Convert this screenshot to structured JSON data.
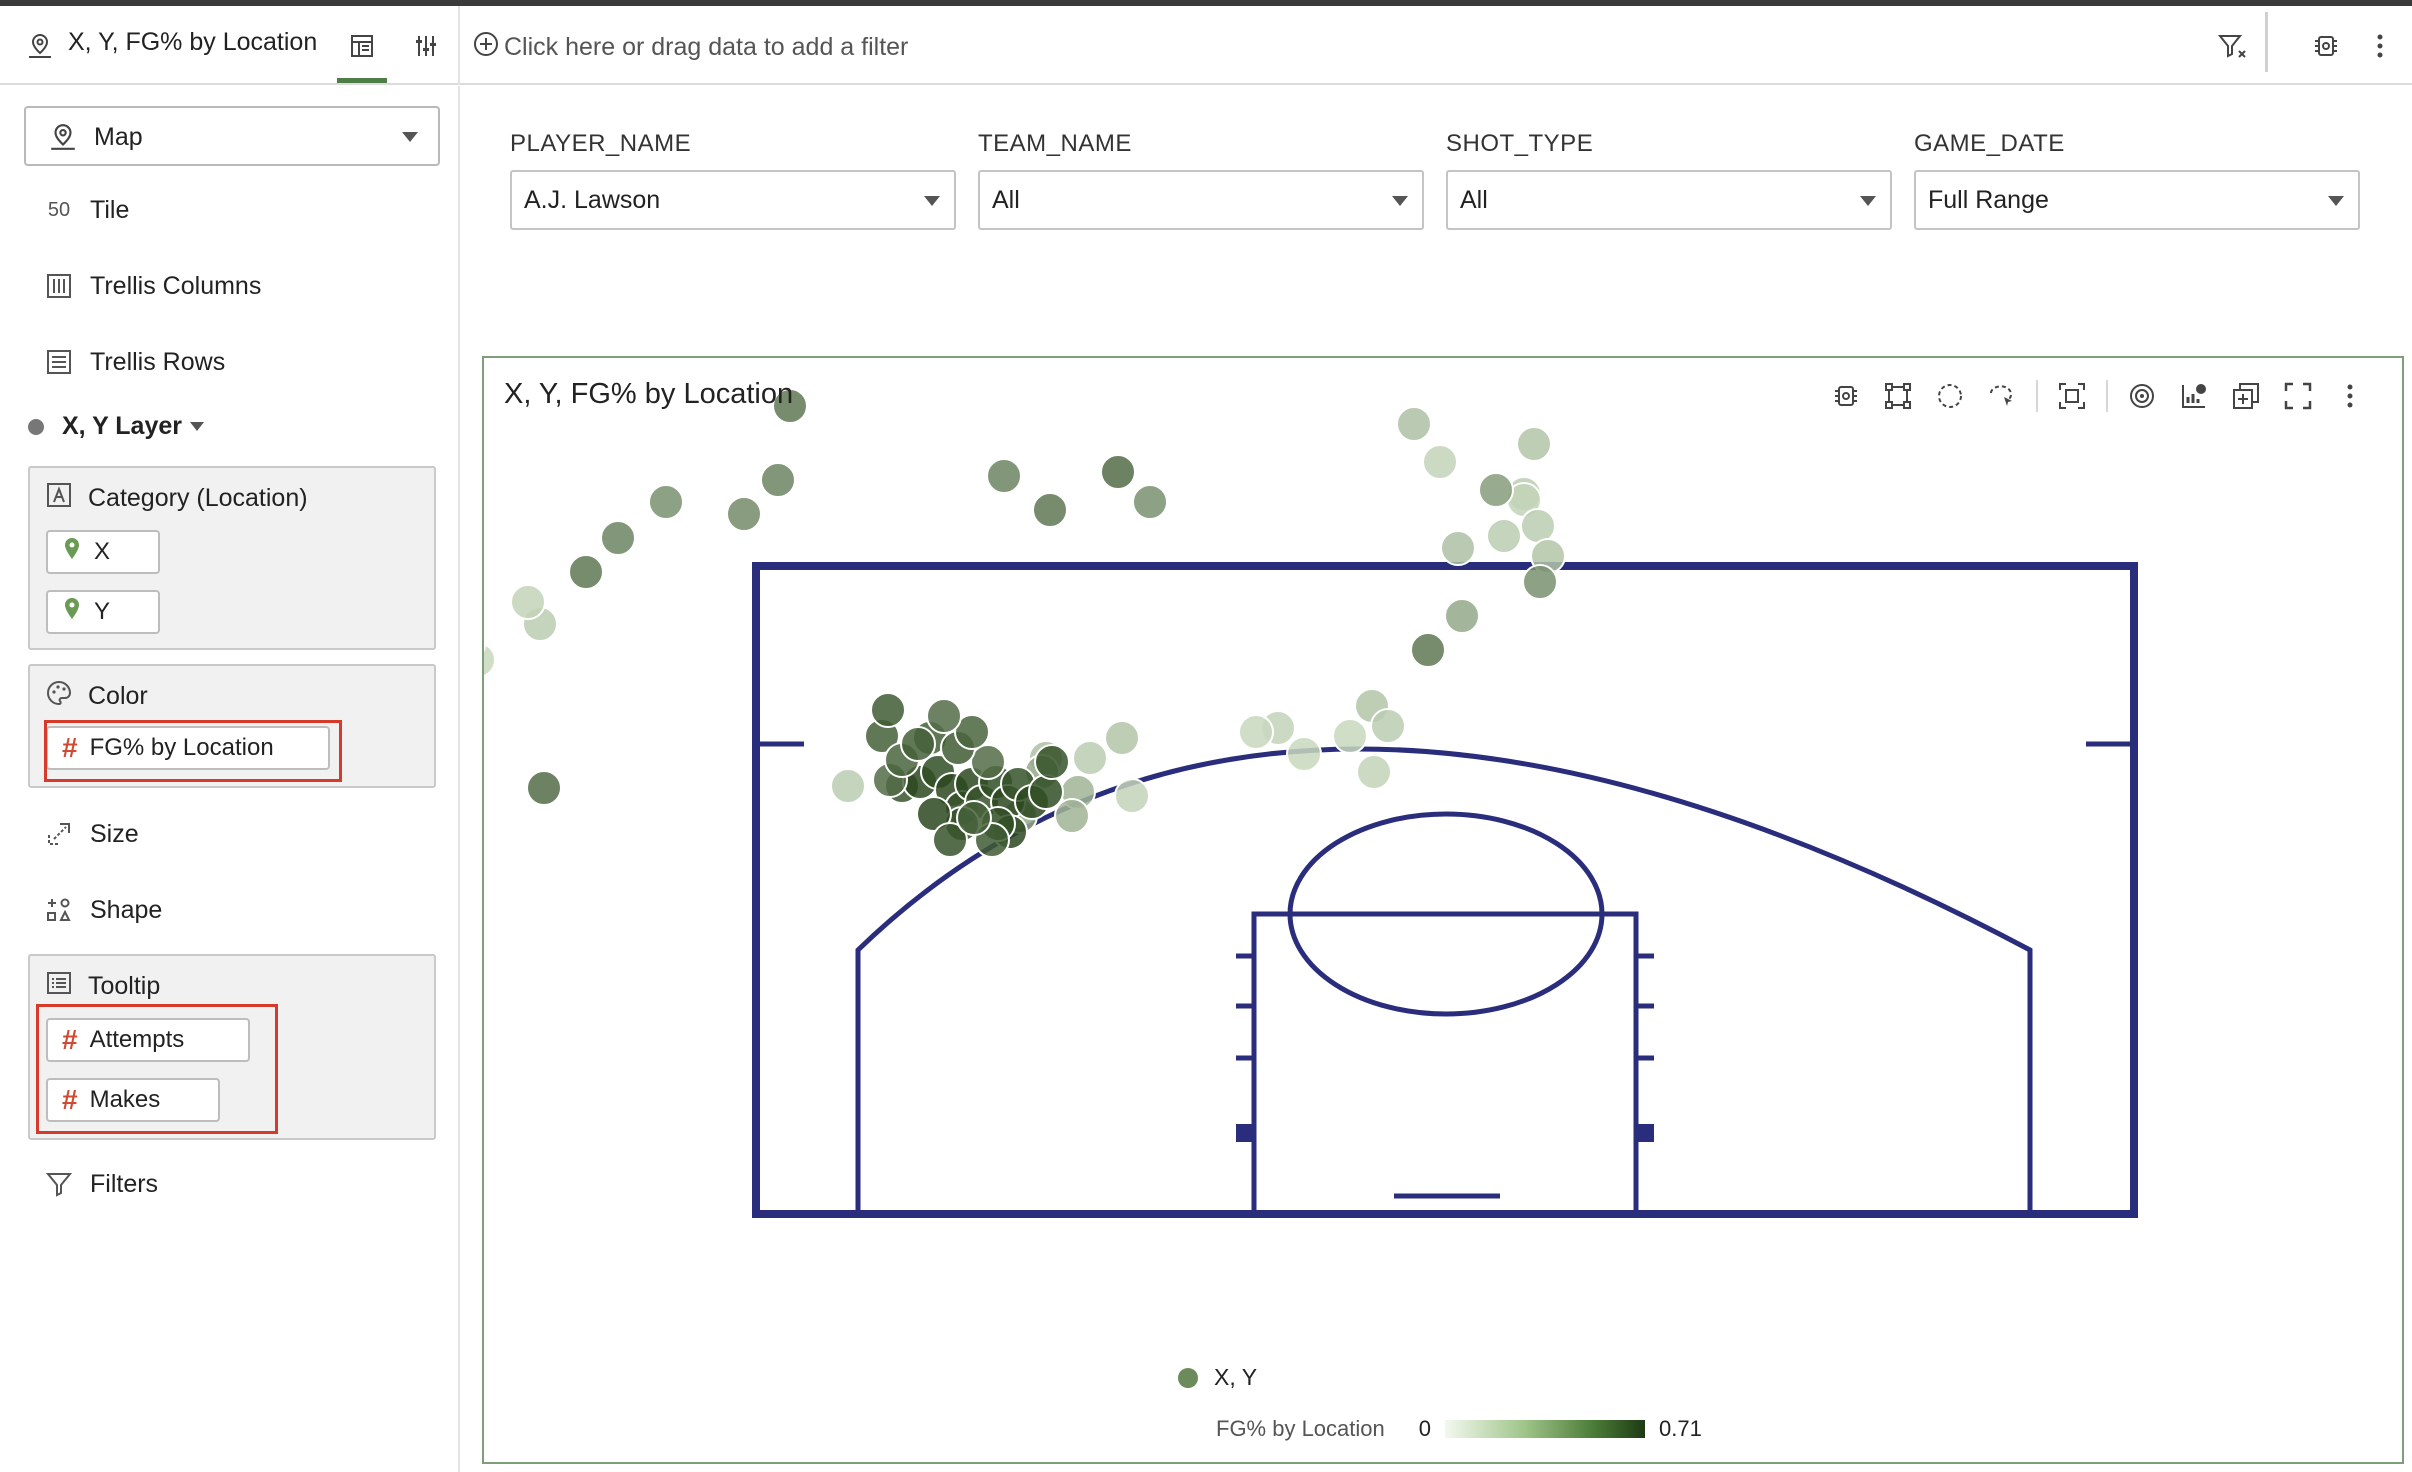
{
  "toolbar": {
    "title": "X, Y, FG% by Location",
    "filter_hint": "Click here or drag data to add a filter"
  },
  "sidebar": {
    "viz_type": "Map",
    "items": {
      "tile": "Tile",
      "tile_icon_text": "50",
      "trellis_columns": "Trellis Columns",
      "trellis_rows": "Trellis Rows",
      "size": "Size",
      "shape": "Shape",
      "filters": "Filters"
    },
    "layer": {
      "name": "X, Y Layer"
    },
    "category": {
      "title": "Category (Location)",
      "pills": [
        "X",
        "Y"
      ]
    },
    "color": {
      "title": "Color",
      "pills": [
        "FG% by Location"
      ]
    },
    "tooltip": {
      "title": "Tooltip",
      "pills": [
        "Attempts",
        "Makes"
      ]
    }
  },
  "filters": [
    {
      "label": "PLAYER_NAME",
      "value": "A.J. Lawson"
    },
    {
      "label": "TEAM_NAME",
      "value": "All"
    },
    {
      "label": "SHOT_TYPE",
      "value": "All"
    },
    {
      "label": "GAME_DATE",
      "value": "Full Range"
    }
  ],
  "panel": {
    "title": "X, Y, FG% by Location",
    "legend_series": "X, Y",
    "legend_color_label": "FG% by Location",
    "legend_min": "0",
    "legend_max": "0.71"
  },
  "colors": {
    "accent": "#4f7d47",
    "court_line": "#2a2d7c",
    "highlight": "#d63a2a"
  },
  "chart_data": {
    "type": "scatter",
    "x_range": [
      0,
      100
    ],
    "y_range": [
      0,
      100
    ],
    "color_range": [
      0,
      0.71
    ],
    "points": [
      [
        44,
        41,
        0.15
      ],
      [
        54,
        43,
        0.18
      ],
      [
        80,
        40,
        0.12
      ],
      [
        110,
        52,
        0.16
      ],
      [
        100,
        65,
        0.2
      ],
      [
        140,
        66,
        0.15
      ],
      [
        160,
        73,
        0.2
      ],
      [
        175,
        78,
        0.18
      ],
      [
        225,
        74,
        0.1
      ],
      [
        240,
        66,
        0.12
      ],
      [
        245,
        55,
        0.1
      ],
      [
        220,
        60,
        0.15
      ],
      [
        275,
        71,
        0.15
      ],
      [
        260,
        75,
        0.12
      ],
      [
        305,
        72,
        0.5
      ],
      [
        350,
        64,
        0.45
      ],
      [
        385,
        74,
        0.4
      ],
      [
        430,
        66,
        0.42
      ],
      [
        470,
        72,
        0.45
      ],
      [
        490,
        77,
        0.5
      ],
      [
        560,
        78,
        0.45
      ],
      [
        590,
        80,
        0.5
      ],
      [
        630,
        76,
        0.55
      ],
      [
        670,
        64,
        0.4
      ],
      [
        130,
        83,
        0.6
      ],
      [
        290,
        86,
        0.55
      ],
      [
        150,
        95,
        0.2
      ],
      [
        120,
        105,
        0.15
      ],
      [
        100,
        105,
        0.12
      ],
      [
        110,
        10,
        0.2
      ],
      [
        140,
        12,
        0.12
      ],
      [
        160,
        6,
        0.15
      ],
      [
        175,
        20,
        0.2
      ],
      [
        120,
        20,
        0.18
      ],
      [
        90,
        23,
        0.15
      ],
      [
        110,
        26,
        0.12
      ],
      [
        130,
        25,
        0.15
      ],
      [
        150,
        30,
        0.18
      ],
      [
        670,
        32,
        0.4
      ],
      [
        610,
        22,
        0.35
      ],
      [
        560,
        25,
        0.3
      ],
      [
        500,
        27,
        0.5
      ],
      [
        450,
        10,
        0.18
      ],
      [
        470,
        14,
        0.15
      ],
      [
        380,
        33,
        0.12
      ],
      [
        370,
        40,
        0.1
      ],
      [
        412,
        49,
        0.1
      ],
      [
        340,
        40,
        0.12
      ],
      [
        320,
        30,
        0.1
      ],
      [
        575,
        45,
        0.15
      ],
      [
        560,
        49,
        0.2
      ],
      [
        600,
        55,
        0.12
      ],
      [
        620,
        60,
        0.25
      ],
      [
        640,
        50,
        0.18
      ],
      [
        555,
        30,
        0.3
      ],
      [
        585,
        38,
        0.25
      ],
      [
        600,
        40,
        0.3
      ],
      [
        350,
        30,
        0.15
      ],
      [
        390,
        26,
        0.65
      ],
      [
        400,
        35,
        0.7
      ],
      [
        405,
        45,
        0.68
      ],
      [
        415,
        30,
        0.7
      ],
      [
        420,
        20,
        0.65
      ],
      [
        430,
        35,
        0.7
      ],
      [
        440,
        25,
        0.65
      ],
      [
        450,
        40,
        0.68
      ],
      [
        460,
        30,
        0.7
      ],
      [
        470,
        20,
        0.66
      ],
      [
        480,
        35,
        0.7
      ],
      [
        490,
        25,
        0.68
      ],
      [
        500,
        40,
        0.66
      ],
      [
        510,
        30,
        0.7
      ],
      [
        520,
        22,
        0.68
      ],
      [
        530,
        35,
        0.66
      ],
      [
        540,
        25,
        0.7
      ],
      [
        395,
        50,
        0.55
      ],
      [
        410,
        58,
        0.6
      ],
      [
        425,
        54,
        0.62
      ],
      [
        440,
        50,
        0.58
      ],
      [
        455,
        60,
        0.55
      ],
      [
        475,
        55,
        0.6
      ],
      [
        490,
        48,
        0.62
      ],
      [
        505,
        58,
        0.55
      ],
      [
        520,
        46,
        0.58
      ],
      [
        455,
        18,
        0.6
      ],
      [
        470,
        10,
        0.65
      ],
      [
        485,
        15,
        0.62
      ],
      [
        500,
        12,
        0.6
      ]
    ]
  }
}
